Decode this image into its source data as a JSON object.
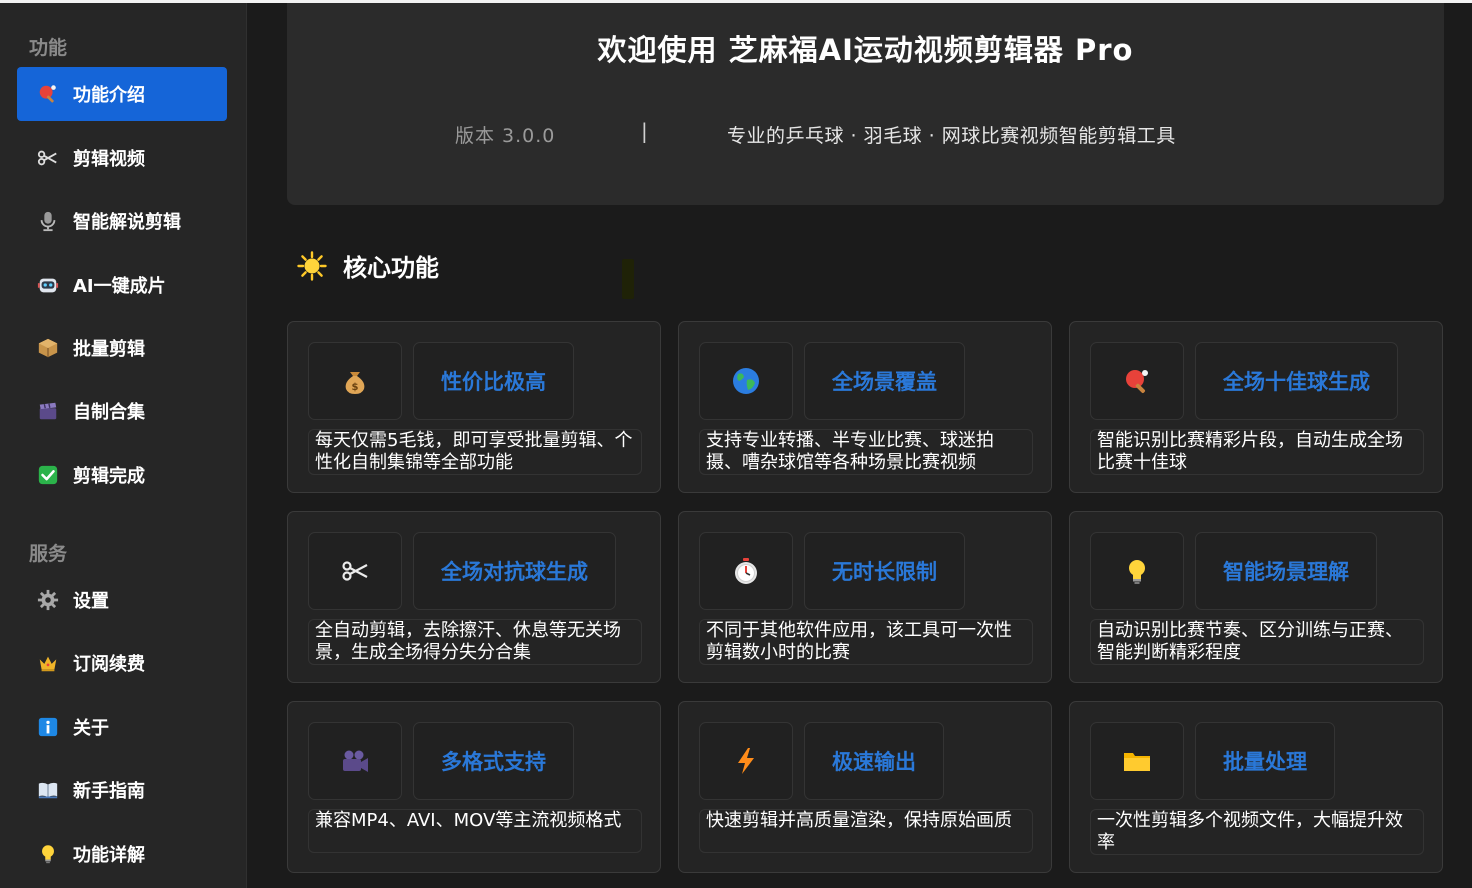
{
  "sidebar": {
    "section_features": "功能",
    "section_services": "服务",
    "items": [
      {
        "label": "功能介绍",
        "icon": "ping-pong-icon",
        "active": true
      },
      {
        "label": "剪辑视频",
        "icon": "scissors-icon",
        "active": false
      },
      {
        "label": "智能解说剪辑",
        "icon": "microphone-icon",
        "active": false
      },
      {
        "label": "AI一键成片",
        "icon": "robot-icon",
        "active": false
      },
      {
        "label": "批量剪辑",
        "icon": "package-icon",
        "active": false
      },
      {
        "label": "自制合集",
        "icon": "clapperboard-icon",
        "active": false
      },
      {
        "label": "剪辑完成",
        "icon": "check-icon",
        "active": false
      }
    ],
    "service_items": [
      {
        "label": "设置",
        "icon": "gear-icon"
      },
      {
        "label": "订阅续费",
        "icon": "crown-icon"
      },
      {
        "label": "关于",
        "icon": "info-icon"
      },
      {
        "label": "新手指南",
        "icon": "book-icon"
      },
      {
        "label": "功能详解",
        "icon": "lightbulb-icon"
      }
    ]
  },
  "hero": {
    "title": "欢迎使用 芝麻福AI运动视频剪辑器 Pro",
    "version": "版本 3.0.0",
    "separator": "|",
    "subtitle": "专业的乒乓球 · 羽毛球 · 网球比赛视频智能剪辑工具"
  },
  "core": {
    "title": "核心功能",
    "icon": "sun-icon",
    "features": [
      {
        "title": "性价比极高",
        "icon": "money-bag-icon",
        "desc": "每天仅需5毛钱，即可享受批量剪辑、个性化自制集锦等全部功能"
      },
      {
        "title": "全场景覆盖",
        "icon": "globe-icon",
        "desc": "支持专业转播、半专业比赛、球迷拍摄、嘈杂球馆等各种场景比赛视频"
      },
      {
        "title": "全场十佳球生成",
        "icon": "ping-pong-icon",
        "desc": "智能识别比赛精彩片段，自动生成全场比赛十佳球"
      },
      {
        "title": "全场对抗球生成",
        "icon": "scissors-icon",
        "desc": "全自动剪辑，去除擦汗、休息等无关场景，生成全场得分失分合集"
      },
      {
        "title": "无时长限制",
        "icon": "stopwatch-icon",
        "desc": "不同于其他软件应用，该工具可一次性剪辑数小时的比赛"
      },
      {
        "title": "智能场景理解",
        "icon": "lightbulb-icon",
        "desc": "自动识别比赛节奏、区分训练与正赛、智能判断精彩程度"
      },
      {
        "title": "多格式支持",
        "icon": "video-camera-icon",
        "desc": "兼容MP4、AVI、MOV等主流视频格式"
      },
      {
        "title": "极速输出",
        "icon": "lightning-icon",
        "desc": "快速剪辑并高质量渲染，保持原始画质"
      },
      {
        "title": "批量处理",
        "icon": "folder-icon",
        "desc": "一次性剪辑多个视频文件，大幅提升效率"
      }
    ]
  },
  "colors": {
    "accent": "#1565d8",
    "feature_title": "#2a78d8",
    "background": "#1b1b1b"
  }
}
